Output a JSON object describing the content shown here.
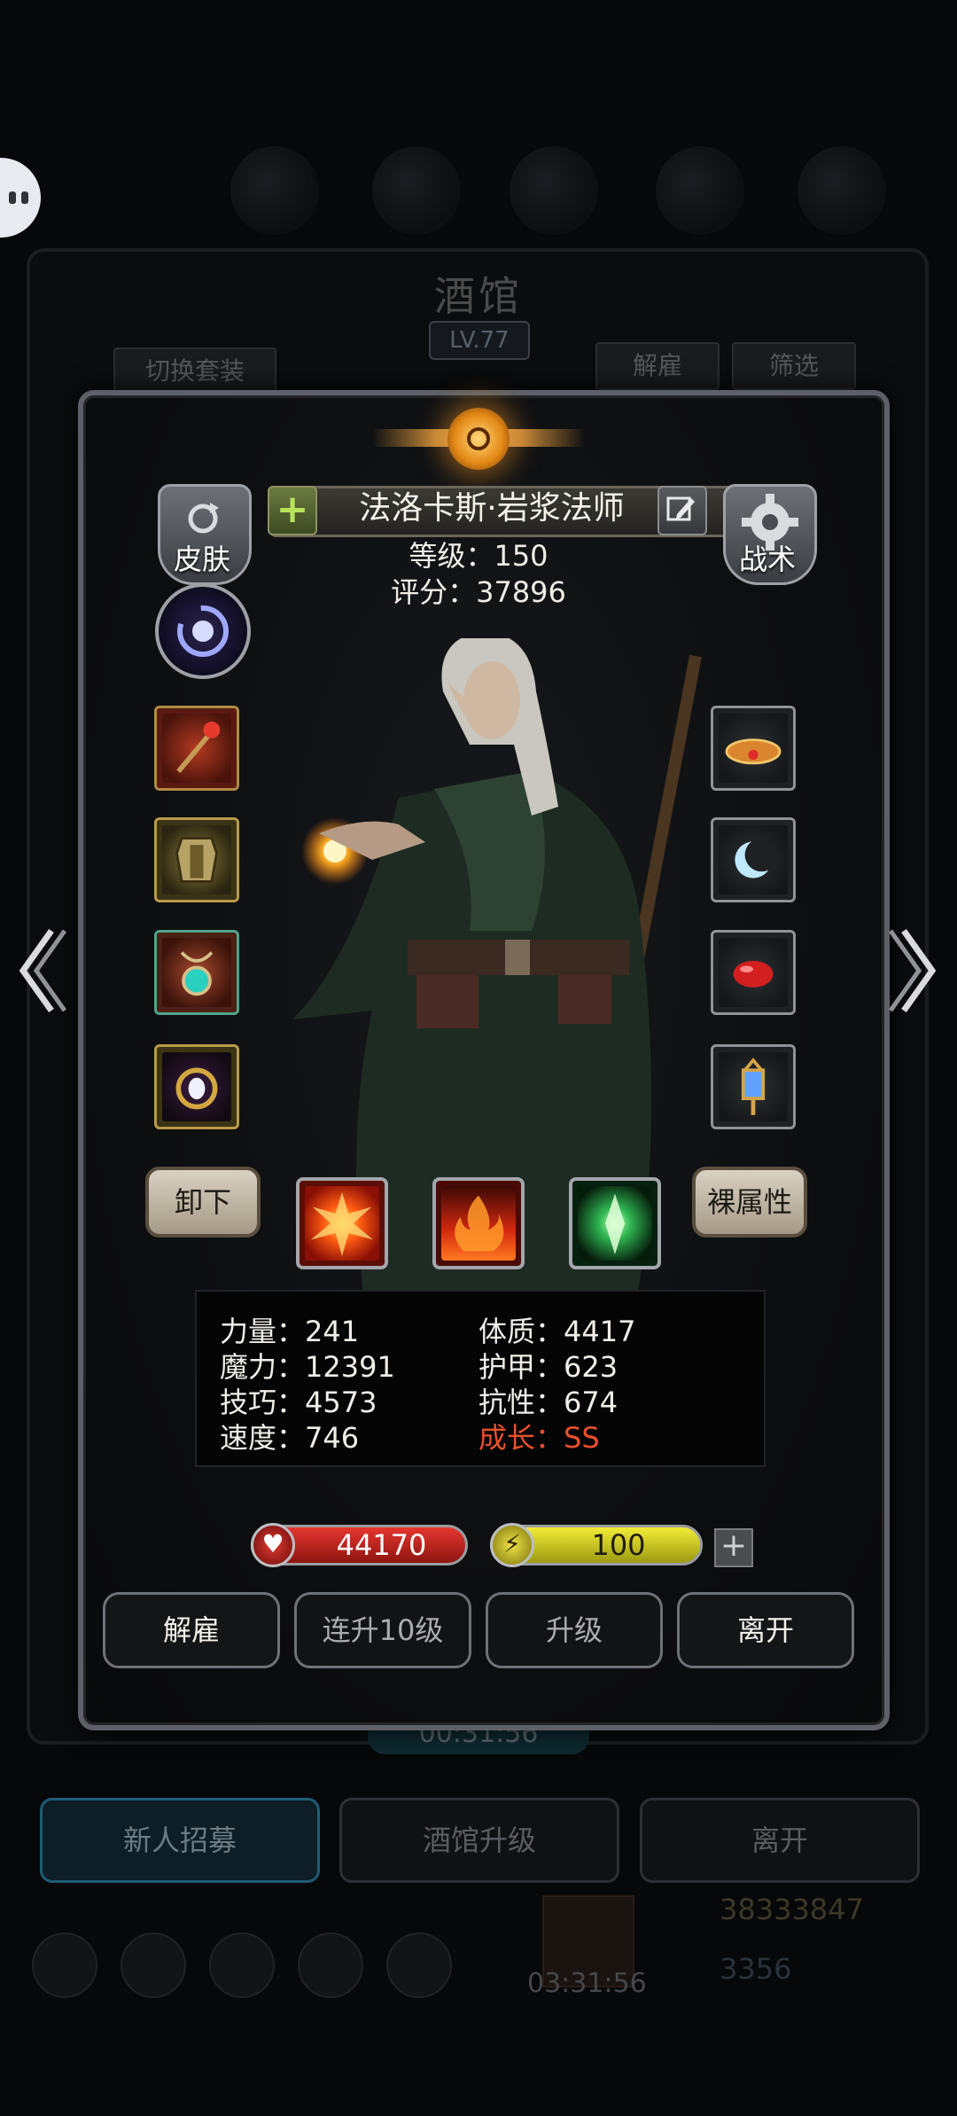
{
  "background": {
    "title": "酒馆",
    "level": "LV.77",
    "tab_switch_outfit": "切换套装",
    "tab_dismiss": "解雇",
    "tab_filter": "筛选",
    "timer": "00:31:56",
    "buttons": [
      "新人招募",
      "酒馆升级",
      "离开"
    ],
    "gold": "38333847",
    "gems": "3356",
    "gift_timer": "03:31:56"
  },
  "hero": {
    "name": "法洛卡斯·岩浆法师",
    "level_text": "等级：150",
    "score_text": "评分：37896",
    "skin_label": "皮肤",
    "tactics_label": "战术",
    "unequip_label": "卸下",
    "base_attr_label": "裸属性"
  },
  "equipment": {
    "left": [
      "staff-icon",
      "armor-icon",
      "amulet-icon",
      "ring-gem-icon"
    ],
    "right": [
      "crown-icon",
      "moon-icon",
      "red-gem-icon",
      "lantern-icon"
    ]
  },
  "skills": [
    "explosion-icon",
    "flame-icon",
    "green-crystal-icon"
  ],
  "stats": {
    "strength": "力量：241",
    "magic": "魔力：12391",
    "skill": "技巧：4573",
    "speed": "速度：746",
    "constitution": "体质：4417",
    "armor": "护甲：623",
    "resistance": "抗性：674",
    "growth": "成长：SS"
  },
  "resources": {
    "hp": "44170",
    "energy": "100"
  },
  "actions": {
    "dismiss": "解雇",
    "level_up_10": "连升10级",
    "level_up": "升级",
    "leave": "离开"
  },
  "colors": {
    "growth": "#e7502b",
    "hp_bar": "#e5362f",
    "energy_bar": "#f2ec36"
  }
}
